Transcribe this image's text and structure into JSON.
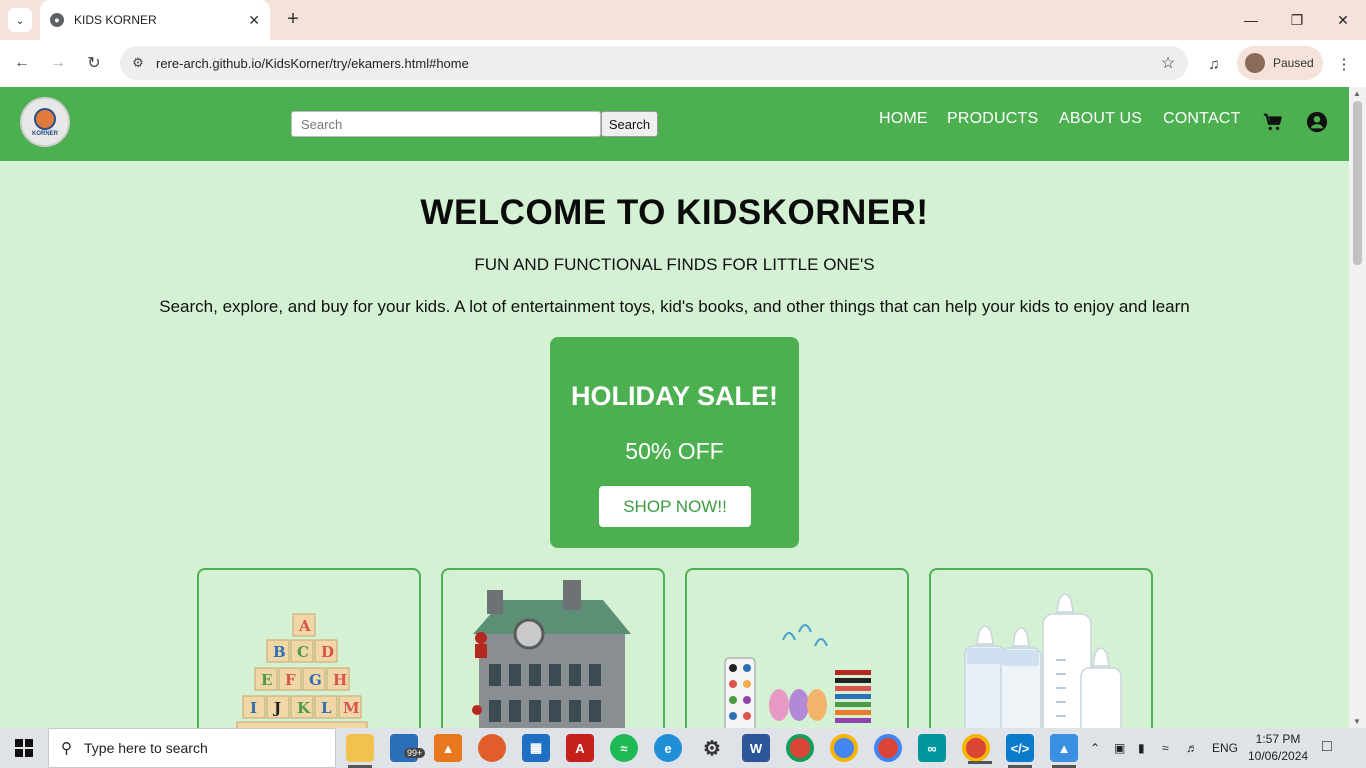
{
  "browser": {
    "tab_title": "KIDS KORNER",
    "url": "rere-arch.github.io/KidsKorner/try/ekamers.html#home",
    "profile_label": "Paused"
  },
  "header": {
    "logo_text": "KORNER",
    "search_placeholder": "Search",
    "search_button": "Search",
    "nav": [
      "HOME",
      "PRODUCTS",
      "ABOUT US",
      "CONTACT"
    ]
  },
  "hero": {
    "title": "WELCOME TO KIDSKORNER!",
    "subtitle": "FUN AND FUNCTIONAL FINDS FOR LITTLE ONE'S",
    "description": "Search, explore, and buy for your kids. A lot of entertainment toys, kid's books, and other things that can help your kids to enjoy and learn"
  },
  "promo": {
    "title": "HOLIDAY SALE!",
    "discount": "50% OFF",
    "button": "SHOP NOW!!"
  },
  "products": [
    {
      "image": "alphabet-blocks",
      "letters": [
        "A",
        "B",
        "C",
        "D",
        "E",
        "F",
        "G",
        "H",
        "I",
        "J",
        "K",
        "L",
        "M"
      ]
    },
    {
      "image": "lego-building"
    },
    {
      "image": "art-supplies"
    },
    {
      "image": "baby-bottles"
    }
  ],
  "colors": {
    "primary_green": "#4caf50",
    "page_background": "#d4f1d4",
    "tab_strip": "#f5e2da"
  },
  "taskbar": {
    "search_placeholder": "Type here to search",
    "mail_badge": "99+",
    "language": "ENG",
    "time": "1:57 PM",
    "date": "10/06/2024",
    "apps": [
      "file-explorer",
      "mail",
      "vlc",
      "firefox",
      "store",
      "acrobat",
      "spotify",
      "edge",
      "settings",
      "word",
      "chrome-profile",
      "chrome",
      "chrome-profile-2",
      "arduino",
      "chrome-active",
      "vscode",
      "photos"
    ]
  }
}
